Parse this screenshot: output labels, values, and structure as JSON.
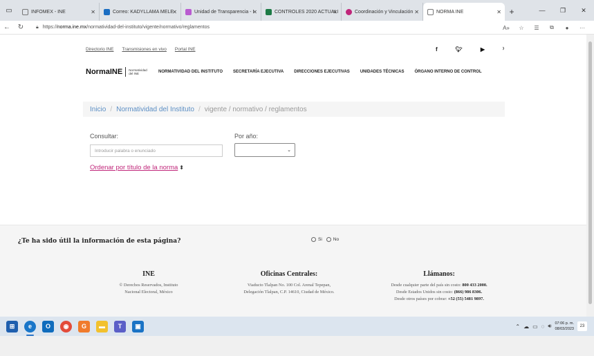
{
  "browser": {
    "tabs": [
      {
        "title": "INFOMEX - INE",
        "color": "#ffffff"
      },
      {
        "title": "Correo: KADYLLAMA MELE",
        "color": "#1b6ec2"
      },
      {
        "title": "Unidad de Transparencia - I",
        "color": "#b95bd0"
      },
      {
        "title": "CONTROLES 2020 ACTUALI",
        "color": "#1d7a45"
      },
      {
        "title": "Coordinación y Vinculación",
        "color": "#c0267a"
      },
      {
        "title": "NORMA INE",
        "color": "#ffffff"
      }
    ],
    "url_prefix": "https://",
    "url_host": "norma.ine.mx",
    "url_path": "/normatividad-del-instituto/vigente/normativo/reglamentos"
  },
  "toplinks": {
    "directorio": "Directorio INE",
    "transmisiones": "Transmisiones en vivo",
    "portal": "Portal INE"
  },
  "brand": {
    "logo": "NormaINE",
    "sub": "Normatividad del INE"
  },
  "nav": {
    "items": [
      "NORMATIVIDAD DEL INSTITUTO",
      "SECRETARÍA EJECUTIVA",
      "DIRECCIONES EJECUTIVAS",
      "UNIDADES TÉCNICAS",
      "ÓRGANO INTERNO DE CONTROL"
    ]
  },
  "breadcrumb": {
    "home": "Inicio",
    "section": "Normatividad del Instituto",
    "current": "vigente / normativo / reglamentos"
  },
  "search": {
    "label": "Consultar:",
    "placeholder": "Introducir palabra o enunciado",
    "year_label": "Por año:",
    "sort_label": "Ordenar por título de la norma"
  },
  "feedback": {
    "question": "¿Te ha sido útil la información de esta página?",
    "yes": "Si",
    "no": "No"
  },
  "footer": {
    "col1": {
      "title": "INE",
      "line1": "© Derechos Reservados, Instituto",
      "line2": "Nacional Electoral, México"
    },
    "col2": {
      "title": "Oficinas Centrales:",
      "line1": "Viaducto Tlalpan No. 100 Col. Arenal Tepepan,",
      "line2": "Delegación Tlalpan, C.P. 14610, Ciudad de México."
    },
    "col3": {
      "title": "Llámanos:",
      "l1_text": "Desde cualquier parte del país sin costo:",
      "l1_num": "800 433 2000.",
      "l2_text": "Desde Estados Unidos sin costo:",
      "l2_num": "(866) 986 8306.",
      "l3_text": "Desde otros países por cobrar:",
      "l3_num": "+52 (55) 5481 9897."
    }
  },
  "taskbar": {
    "time": "07:06 p. m.",
    "date": "08/03/2023",
    "notifications": "23"
  }
}
